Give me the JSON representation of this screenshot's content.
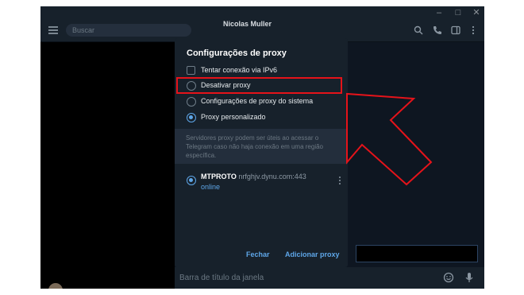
{
  "window": {
    "title": "Nicolas Muller",
    "controls": {
      "minimize": "–",
      "maximize": "□",
      "close": "✕"
    }
  },
  "toolbar": {
    "search_placeholder": "Buscar",
    "icons": [
      "search-icon",
      "phone-icon",
      "sidebar-icon",
      "more-icon"
    ]
  },
  "dialog": {
    "title": "Configurações de proxy",
    "ipv6_label": "Tentar conexão via IPv6",
    "options": [
      {
        "label": "Desativar proxy",
        "selected": false
      },
      {
        "label": "Configurações de proxy do sistema",
        "selected": false
      },
      {
        "label": "Proxy personalizado",
        "selected": true
      }
    ],
    "info_text": "Servidores proxy podem ser úteis ao acessar o Telegram caso não haja conexão em uma região específica.",
    "proxy": {
      "type": "MTPROTO",
      "address": "nrfghjv.dynu.com:443",
      "status": "online"
    },
    "close_label": "Fechar",
    "add_label": "Adicionar proxy"
  },
  "message_bar": {
    "placeholder": "Barra de título da janela"
  },
  "colors": {
    "accent": "#5ea6e8",
    "highlight": "#e5131a",
    "dialog_bg": "#17212b",
    "window_bg": "#0e1621"
  }
}
